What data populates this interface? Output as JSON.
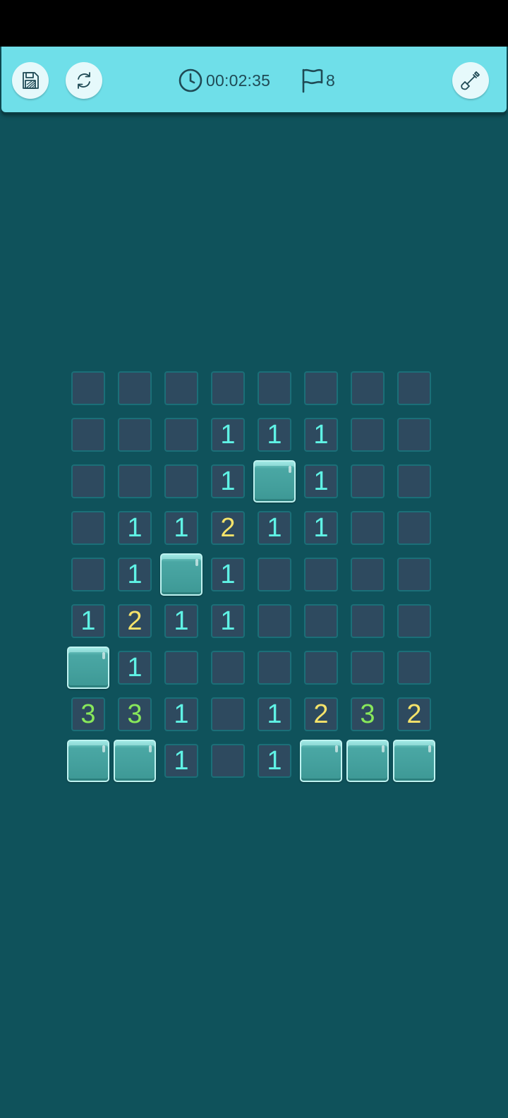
{
  "toolbar": {
    "save_icon": "save-icon",
    "restart_icon": "restart-icon",
    "timer_icon": "clock-icon",
    "timer": "00:02:35",
    "flag_icon": "flag-icon",
    "flags": "8",
    "tool_icon": "shovel-icon"
  },
  "colors": {
    "background": "#0f525b",
    "toolbar": "#6fdfe9",
    "revealed_cell": "#2e4a5f",
    "covered_cell": "#44a09d",
    "number_1": "#5ff2e5",
    "number_2": "#f5e36a",
    "number_3": "#88e85a"
  },
  "board": {
    "rows": 9,
    "cols": 8,
    "legend": "'' = revealed empty, '#' = covered tile, digits = revealed mine counts",
    "grid": [
      [
        "",
        "",
        "",
        "",
        "",
        "",
        "",
        ""
      ],
      [
        "",
        "",
        "",
        "1",
        "1",
        "1",
        "",
        ""
      ],
      [
        "",
        "",
        "",
        "1",
        "#",
        "1",
        "",
        ""
      ],
      [
        "",
        "1",
        "1",
        "2",
        "1",
        "1",
        "",
        ""
      ],
      [
        "",
        "1",
        "#",
        "1",
        "",
        "",
        "",
        ""
      ],
      [
        "1",
        "2",
        "1",
        "1",
        "",
        "",
        "",
        ""
      ],
      [
        "#",
        "1",
        "",
        "",
        "",
        "",
        "",
        ""
      ],
      [
        "3",
        "3",
        "1",
        "",
        "1",
        "2",
        "3",
        "2"
      ],
      [
        "#",
        "#",
        "1",
        "",
        "1",
        "#",
        "#",
        "#"
      ]
    ]
  }
}
